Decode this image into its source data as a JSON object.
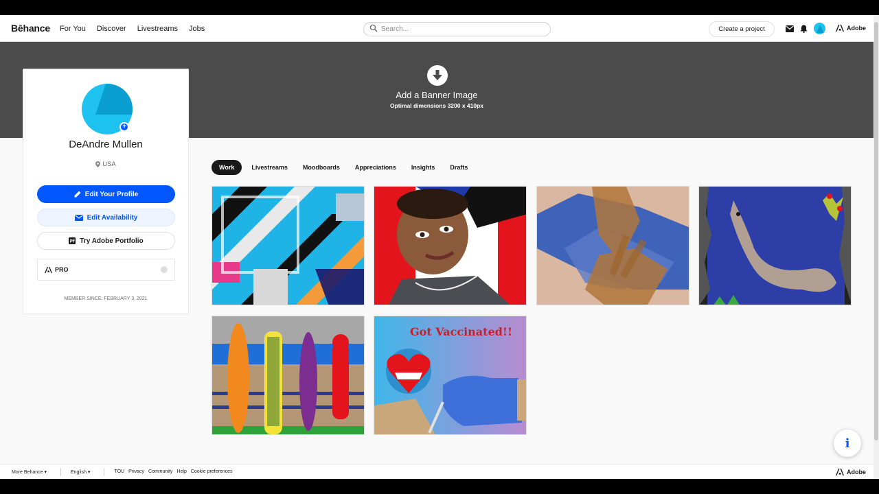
{
  "header": {
    "logo": "Bēhance",
    "nav": [
      "For You",
      "Discover",
      "Livestreams",
      "Jobs"
    ],
    "search_placeholder": "Search...",
    "create_project": "Create a project",
    "adobe_label": "Adobe"
  },
  "banner": {
    "title": "Add a Banner Image",
    "subtitle": "Optimal dimensions 3200 x 410px"
  },
  "profile": {
    "name": "DeAndre Mullen",
    "location": "USA",
    "edit_profile": "Edit Your Profile",
    "edit_availability": "Edit Availability",
    "try_portfolio": "Try Adobe Portfolio",
    "pro_label": "PRO",
    "member_since": "MEMBER SINCE: FEBRUARY 3, 2021"
  },
  "tabs": [
    {
      "label": "Work",
      "active": true
    },
    {
      "label": "Livestreams",
      "active": false
    },
    {
      "label": "Moodboards",
      "active": false
    },
    {
      "label": "Appreciations",
      "active": false
    },
    {
      "label": "Insights",
      "active": false
    },
    {
      "label": "Drafts",
      "active": false
    }
  ],
  "projects": {
    "vaccine_art_text": "Got Vaccinated!!"
  },
  "footer": {
    "more_behance": "More Behance ▾",
    "language": "English ▾",
    "links": [
      "TOU",
      "Privacy",
      "Community",
      "Help",
      "Cookie preferences"
    ],
    "adobe_label": "Adobe"
  },
  "colors": {
    "accent": "#0057ff",
    "banner": "#4b4b4b",
    "avatar": "#1ec2f1"
  },
  "icons": {
    "search": "search-icon",
    "mail": "mail-icon",
    "bell": "bell-icon",
    "download": "download-icon",
    "pin": "location-pin-icon",
    "pencil": "pencil-icon",
    "envelope": "envelope-icon",
    "portfolio": "portfolio-icon",
    "info": "info-icon"
  }
}
